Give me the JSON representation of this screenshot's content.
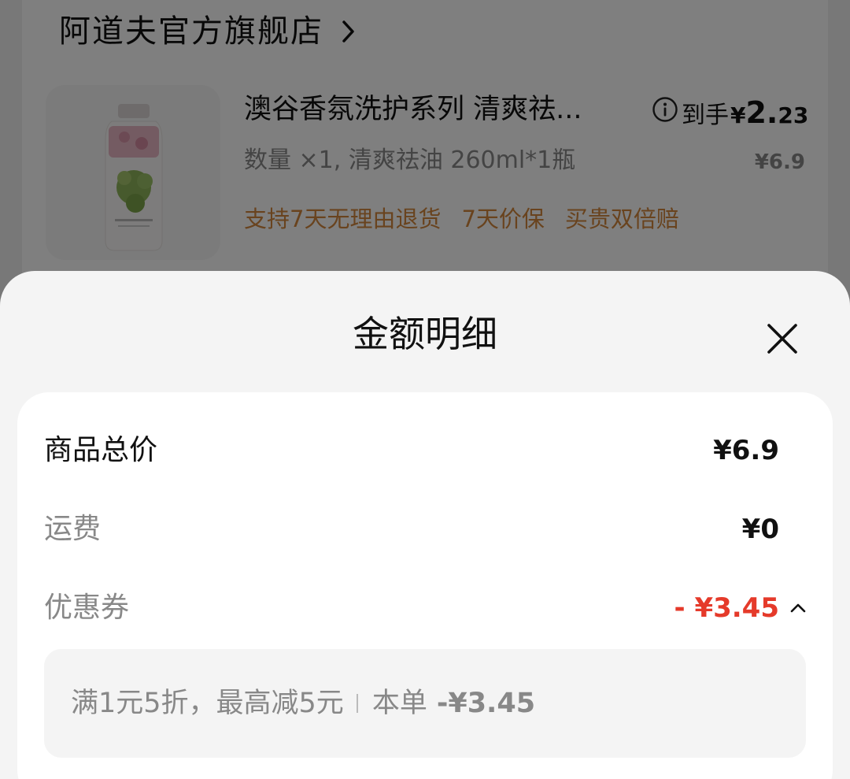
{
  "store": {
    "name": "阿道夫官方旗舰店"
  },
  "product": {
    "title": "澳谷香氛洗护系列 清爽祛...",
    "final_price_label": "到手",
    "final_price_currency": "¥",
    "final_price_integer": "2.",
    "final_price_decimal": "23",
    "spec": "数量 ×1, 清爽祛油 260ml*1瓶",
    "original_price": "¥6.9",
    "guarantees": [
      "支持7天无理由退货",
      "7天价保",
      "买贵双倍赔"
    ],
    "thumbnail_icon": "shampoo-bottle-icon"
  },
  "sheet": {
    "title": "金额明细",
    "rows": [
      {
        "label": "商品总价",
        "value": "¥6.9"
      },
      {
        "label": "运费",
        "value": "¥0"
      },
      {
        "label": "优惠券",
        "value": "- ¥3.45"
      }
    ],
    "coupon": {
      "rule": "满1元5折，最高减5元",
      "order_label": "本单",
      "order_amount": "-¥3.45"
    }
  },
  "colors": {
    "discount_red": "#e53a2a",
    "guarantee_orange": "#d2873c",
    "overlay": "rgba(0,0,0,0.5)"
  }
}
